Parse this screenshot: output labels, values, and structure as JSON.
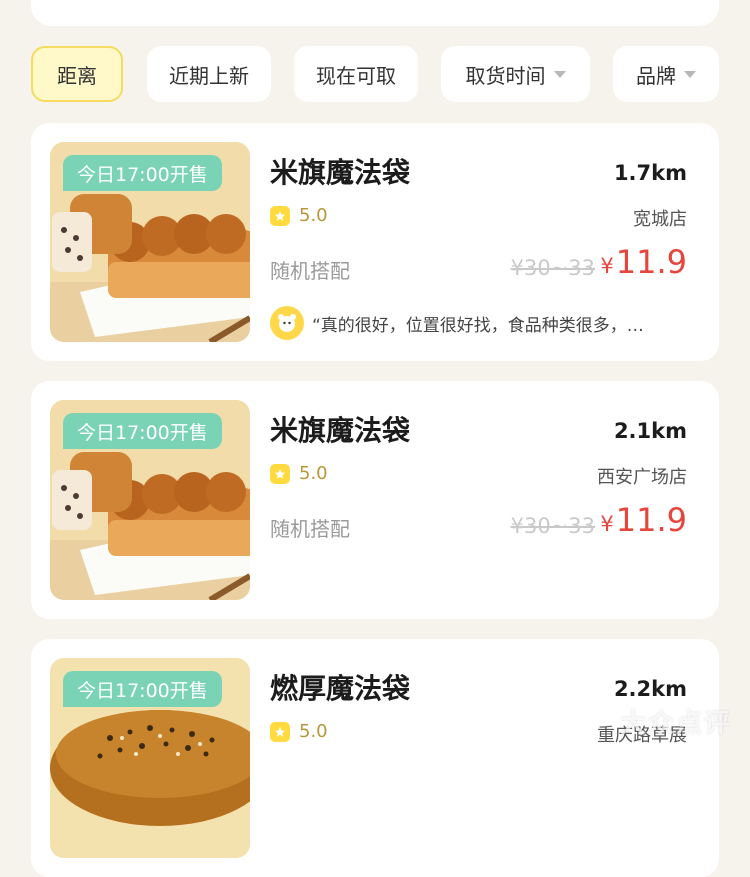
{
  "progress": {
    "fraction": 0.65,
    "color": "#ffd63a"
  },
  "filters": [
    {
      "label": "距离",
      "active": true,
      "has_dropdown": false
    },
    {
      "label": "近期上新",
      "active": false,
      "has_dropdown": false
    },
    {
      "label": "现在可取",
      "active": false,
      "has_dropdown": false
    },
    {
      "label": "取货时间",
      "active": false,
      "has_dropdown": true
    },
    {
      "label": "品牌",
      "active": false,
      "has_dropdown": true
    }
  ],
  "products": [
    {
      "badge": "今日17:00开售",
      "title": "米旗魔法袋",
      "distance": "1.7km",
      "rating": "5.0",
      "store": "宽城店",
      "desc": "随机搭配",
      "orig_price": "¥30~33",
      "currency": "¥",
      "price": "11.9",
      "review": "“真的很好，位置很好找，食品种类很多，…",
      "image": "bread-loaf"
    },
    {
      "badge": "今日17:00开售",
      "title": "米旗魔法袋",
      "distance": "2.1km",
      "rating": "5.0",
      "store": "西安广场店",
      "desc": "随机搭配",
      "orig_price": "¥30~33",
      "currency": "¥",
      "price": "11.9",
      "image": "bread-loaf"
    },
    {
      "badge": "今日17:00开售",
      "title": "燃厚魔法袋",
      "distance": "2.2km",
      "rating": "5.0",
      "store": "重庆路草展",
      "image": "seeded-bread"
    }
  ],
  "watermark": "大众点评",
  "colors": {
    "accent": "#e6453d",
    "badge": "#7bd3b6",
    "star": "#ffdb3f"
  }
}
